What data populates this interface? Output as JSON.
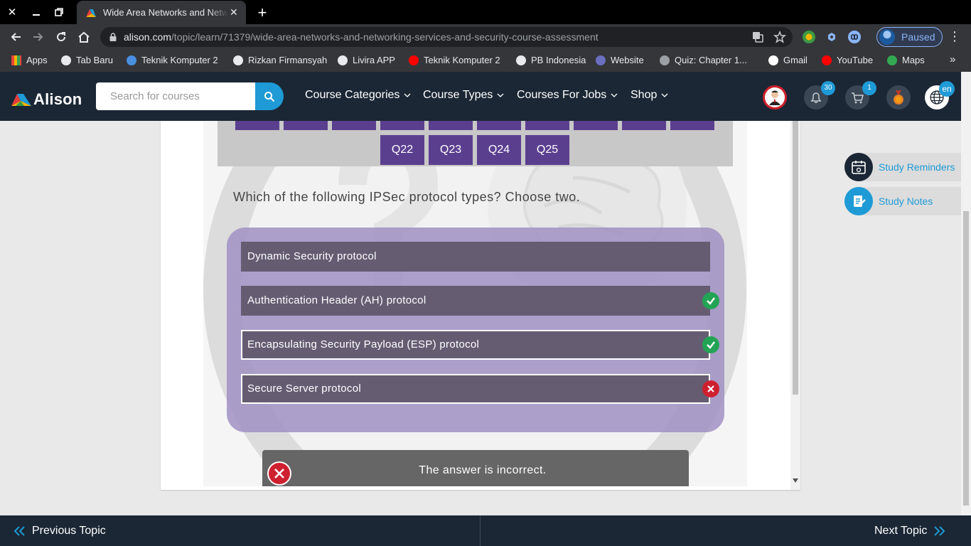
{
  "browser": {
    "tab_title": "Wide Area Networks and Networking Services and Security Course Assessment",
    "url_host": "alison.com",
    "url_path": "/topic/learn/71379/wide-area-networks-and-networking-services-and-security-course-assessment",
    "profile_status": "Paused",
    "bookmarks": [
      {
        "label": "Apps",
        "color": "#e8453c"
      },
      {
        "label": "Tab Baru",
        "color": "#e8eaed"
      },
      {
        "label": "Teknik Komputer 2",
        "color": "#4a8fe0"
      },
      {
        "label": "Rizkan Firmansyah",
        "color": "#e8eaed"
      },
      {
        "label": "Livira APP",
        "color": "#e8eaed"
      },
      {
        "label": "Teknik Komputer 2",
        "color": "#ff0000"
      },
      {
        "label": "PB Indonesia",
        "color": "#e8eaed"
      },
      {
        "label": "Website",
        "color": "#6b6fbf"
      },
      {
        "label": "Quiz: Chapter 1...",
        "color": "#9aa0a6"
      },
      {
        "label": "Gmail",
        "color": "#ffffff"
      },
      {
        "label": "YouTube",
        "color": "#ff0000"
      },
      {
        "label": "Maps",
        "color": "#34a853"
      }
    ]
  },
  "header": {
    "logo_text": "Alison",
    "search_placeholder": "Search for courses",
    "menu": [
      "Course Categories",
      "Course Types",
      "Courses For Jobs",
      "Shop"
    ],
    "notifications_count": "30",
    "cart_count": "1",
    "language": "en"
  },
  "quiz": {
    "question_buttons": [
      "Q22",
      "Q23",
      "Q24",
      "Q25"
    ],
    "question": "Which of the following IPSec protocol types? Choose two.",
    "options": [
      {
        "label": "Dynamic Security protocol",
        "selected": false,
        "status": "none"
      },
      {
        "label": "Authentication Header (AH) protocol",
        "selected": false,
        "status": "correct"
      },
      {
        "label": "Encapsulating Security Payload (ESP) protocol",
        "selected": true,
        "status": "correct"
      },
      {
        "label": "Secure Server protocol",
        "selected": true,
        "status": "incorrect"
      }
    ],
    "result": "The answer is incorrect."
  },
  "study_tools": [
    "Study Reminders",
    "Study Notes"
  ],
  "footer": {
    "previous": "Previous Topic",
    "next": "Next Topic"
  },
  "colors": {
    "header_bg": "#1b2734",
    "accent": "#1e9ad6",
    "question_button": "#5b3f8f",
    "correct": "#23a455",
    "incorrect": "#cf2030"
  }
}
